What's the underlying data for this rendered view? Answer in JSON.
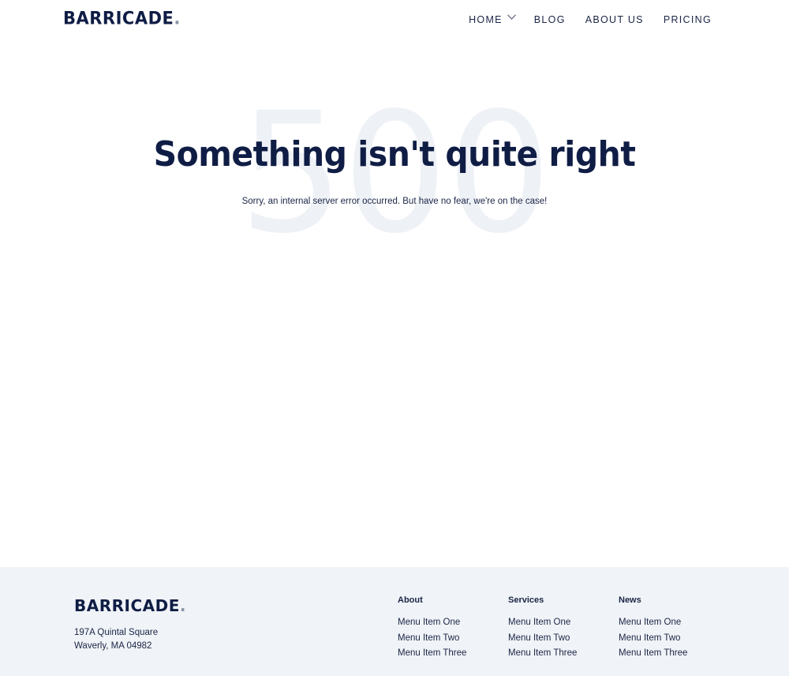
{
  "brand": {
    "name": "BARRICADE",
    "dot": ".",
    "dot_color": "#8a93a8",
    "primary_color": "#0f1d45"
  },
  "nav": {
    "items": [
      {
        "label": "HOME",
        "has_dropdown": true,
        "icon": "chevron-down-icon"
      },
      {
        "label": "BLOG"
      },
      {
        "label": "ABOUT US"
      },
      {
        "label": "PRICING"
      }
    ]
  },
  "error": {
    "code": "500",
    "title": "Something isn't quite right",
    "message": "Sorry, an internal server error occurred. But have no fear, we're on the case!"
  },
  "footer": {
    "background": "#f0f3f7",
    "address_line1": "197A Quintal Square",
    "address_line2": "Waverly, MA 04982",
    "columns": [
      {
        "title": "About",
        "items": [
          "Menu Item One",
          "Menu Item Two",
          "Menu Item Three"
        ]
      },
      {
        "title": "Services",
        "items": [
          "Menu Item One",
          "Menu Item Two",
          "Menu Item Three"
        ]
      },
      {
        "title": "News",
        "items": [
          "Menu Item One",
          "Menu Item Two",
          "Menu Item Three"
        ]
      }
    ]
  }
}
